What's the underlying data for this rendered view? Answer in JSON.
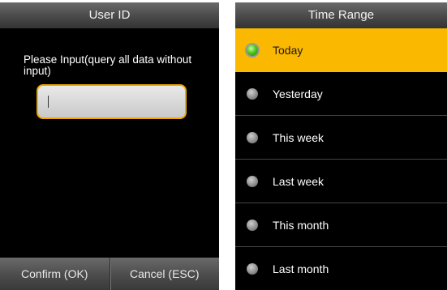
{
  "user_id_screen": {
    "title": "User ID",
    "prompt": "Please Input(query all data without input)",
    "input": {
      "value": ""
    },
    "buttons": {
      "confirm": "Confirm (OK)",
      "cancel": "Cancel (ESC)"
    }
  },
  "time_range_screen": {
    "title": "Time Range",
    "options": [
      {
        "label": "Today",
        "selected": true
      },
      {
        "label": "Yesterday",
        "selected": false
      },
      {
        "label": "This week",
        "selected": false
      },
      {
        "label": "Last week",
        "selected": false
      },
      {
        "label": "This month",
        "selected": false
      },
      {
        "label": "Last month",
        "selected": false
      }
    ]
  },
  "colors": {
    "accent": "#fbb800",
    "radio_selected": "#4fc41e",
    "background": "#000000"
  },
  "icons": {
    "radio_on": "radio-selected-icon",
    "radio_off": "radio-unselected-icon"
  }
}
